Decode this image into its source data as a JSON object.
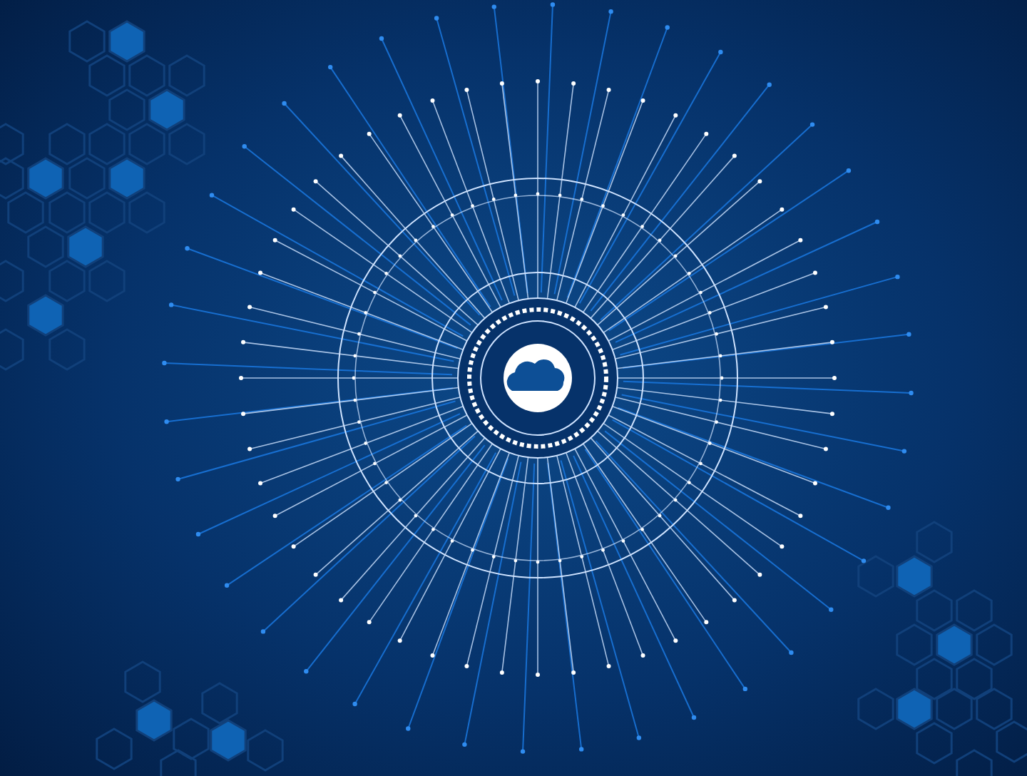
{
  "scene": {
    "kind": "network-cloud"
  }
}
